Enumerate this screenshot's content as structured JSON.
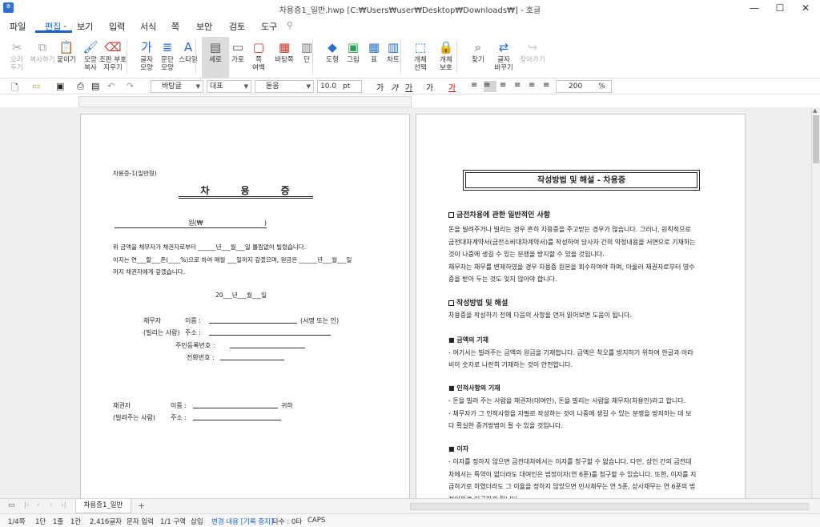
{
  "app": {
    "title": "차용증1_일반.hwp [C:₩Users₩user₩Desktop₩Downloads₩] - 호글"
  },
  "menu": [
    "파일",
    "편집",
    "보기",
    "입력",
    "서식",
    "쪽",
    "보안",
    "검토",
    "도구"
  ],
  "ribbon": [
    {
      "id": "cut",
      "label": [
        "오려",
        "두기"
      ],
      "disabled": true
    },
    {
      "id": "copy",
      "label": [
        "복사하기"
      ],
      "disabled": true
    },
    {
      "id": "paste",
      "label": [
        "붙이기"
      ]
    },
    {
      "id": "format-copy",
      "label": [
        "모양",
        "복사"
      ]
    },
    {
      "id": "clear-format",
      "label": [
        "조판 부호",
        "지우기"
      ]
    },
    {
      "id": "char-shape",
      "label": [
        "글자",
        "모양"
      ]
    },
    {
      "id": "para-shape",
      "label": [
        "문단",
        "모양"
      ]
    },
    {
      "id": "style",
      "label": [
        "스타일"
      ]
    },
    {
      "id": "portrait",
      "label": [
        "세로"
      ]
    },
    {
      "id": "landscape",
      "label": [
        "가로"
      ]
    },
    {
      "id": "margins",
      "label": [
        "쪽",
        "여백"
      ]
    },
    {
      "id": "page-border",
      "label": [
        "바탕쪽"
      ]
    },
    {
      "id": "columns",
      "label": [
        "단"
      ]
    },
    {
      "id": "shapes",
      "label": [
        "도형"
      ]
    },
    {
      "id": "picture",
      "label": [
        "그림"
      ]
    },
    {
      "id": "table",
      "label": [
        "표"
      ]
    },
    {
      "id": "chart",
      "label": [
        "차트"
      ]
    },
    {
      "id": "object-select",
      "label": [
        "개체",
        "선택"
      ]
    },
    {
      "id": "object-protect",
      "label": [
        "개체",
        "보호"
      ]
    },
    {
      "id": "find",
      "label": [
        "찾기"
      ]
    },
    {
      "id": "replace",
      "label": [
        "글자",
        "바꾸기"
      ]
    },
    {
      "id": "go-to",
      "label": [
        "찾아가기"
      ],
      "disabled": true
    }
  ],
  "format": {
    "style": "바탕글",
    "font_set": "대표",
    "font": "돋움",
    "size": "10.0",
    "size_unit": "pt",
    "zoom": "200",
    "zoom_unit": "%"
  },
  "left_page": {
    "header": "차용증-1(일반형)",
    "title": "차      용      증",
    "amount": "원(₩                              )",
    "line1": "위 금액을 채무자가 채권자로부터 ______년___월___일 틀림없이 빌렸습니다.",
    "line2": "이자는 연___할___푼(____%)으로 하여 매월 ___일까지 갚겠으며, 원금은 ______년___월___일",
    "line3": "까지 채권자에게 갚겠습니다.",
    "date": "20___년___월___일",
    "debtor_label": "채무자",
    "debtor_sub": "(빌리는 사람)",
    "name_label": "이름 :",
    "name_suffix": "(서명 또는 인)",
    "address_label": "주소 :",
    "rrn_label": "주민등록번호 :",
    "phone_label": "전화번호 :",
    "creditor_label": "채권자",
    "creditor_sub": "(빌려주는 사람)",
    "c_name_label": "이름 :",
    "c_name_suffix": "귀하",
    "c_address_label": "주소 :"
  },
  "right_page": {
    "title": "작성방법 및 해설 - 차용증",
    "sec1": "금전차용에 관한 일반적인 사항",
    "sec1_p": [
      "돈을 빌려주거나 빌리는 경우 흔히 차용증을 주고받는 경우가 많습니다. 그러나, 원칙적으로",
      "금전대차계약서(금전소비대차계약서)를 작성하여 당사자 간의 약정내용을 서면으로 기재하는",
      "것이 나중에 생길 수 있는 분쟁을 방지할 수 있을 것입니다.",
      "채무자는 채무를 변제하였을 경우 차용증 원본을 회수하여야 하며, 아울러 채권자로부터 영수",
      "증을 받아 두는 것도 잊지 않아야 합니다."
    ],
    "sec2": "작성방법 및 해설",
    "sec2_p": "차용증을 작성하기 전에 다음의 사항을 먼저 읽어보면 도움이 됩니다.",
    "sub1": "■ 금액의 기재",
    "sub1_p": [
      "- 여기서는 빌려주는 금액의 원금을 기재합니다. 금액은 착오를 방지하기 위하여 한글과 아라",
      "비아 숫자로 나란히 기재하는 것이 안전합니다."
    ],
    "sub2": "■ 인적사항의 기재",
    "sub2_p": [
      "- 돈을 빌려 주는 사람을 채권자(대여인), 돈을 빌리는 사람을 채무자(차용인)라고 합니다.",
      "- 채무자가 그 인적사항을 자필로 작성하는 것이 나중에 생길 수 있는 분쟁을 방지하는 데 보",
      "다 확실한 증거방법이 될 수 있을 것입니다."
    ],
    "sub3": "■ 이자",
    "sub3_p": [
      "- 이자를 정하지 않으면 금전대차에서는 이자를 청구할 수 없습니다. 다만, 상인 간의 금전대",
      "차에서는 특약이 없더라도 대여인은 법정이자(연 6푼)를 청구할 수 있습니다. 또한, 이자를 지",
      "급하기로 하였더라도 그 이율을 정하지 않았으면 민사채무는 연 5푼, 상사채무는 연 6푼의 법",
      "정이율로 지급하게 됩니다."
    ]
  },
  "tab": {
    "doc": "차용증1_일반"
  },
  "status": {
    "page": "1/4쪽",
    "col": "1단",
    "line": "1줄",
    "pos": "1칸",
    "chars": "2,416글자",
    "mode": "문자 입력",
    "section": "1/1 구역",
    "insert": "삽입",
    "track": "변경 내용 [기록 중지]",
    "typing": "타수 : 0타",
    "caps": "CAPS"
  }
}
